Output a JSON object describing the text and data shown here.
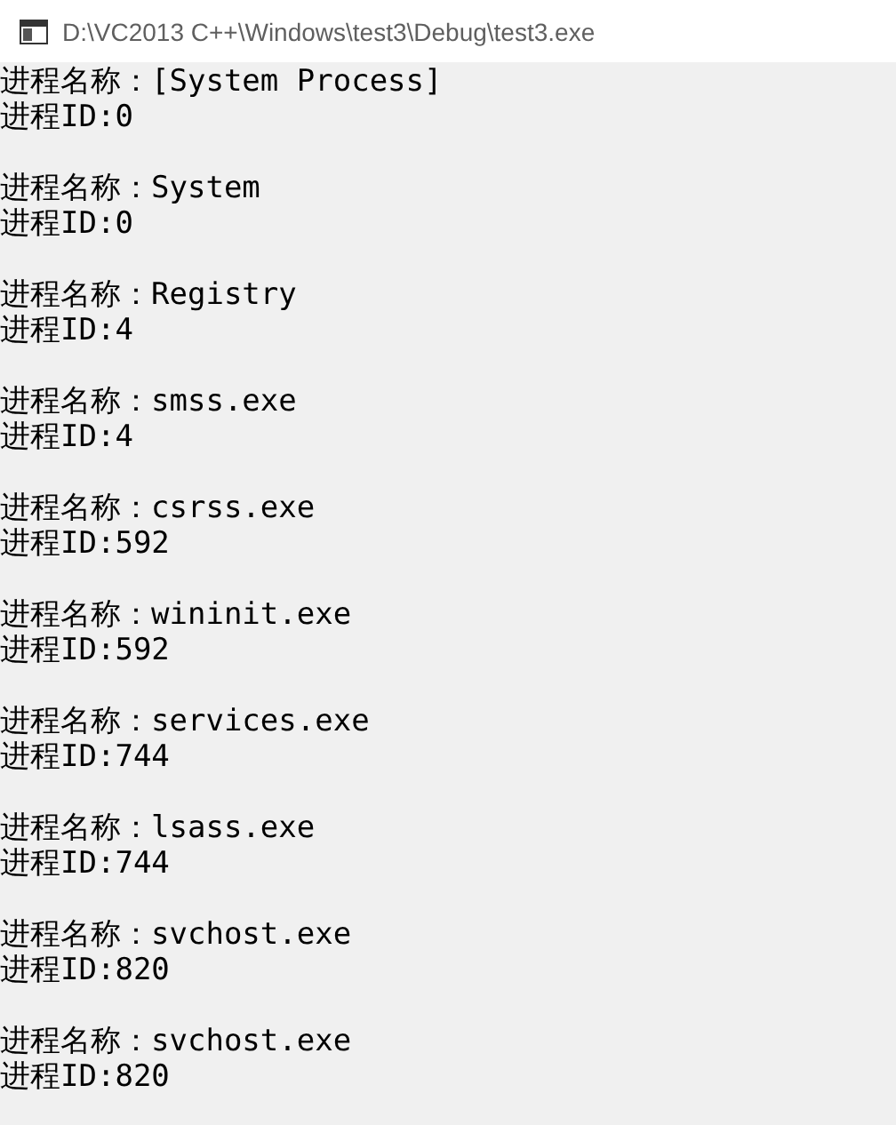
{
  "window": {
    "title": "D:\\VC2013 C++\\Windows\\test3\\Debug\\test3.exe"
  },
  "console": {
    "entries": [
      {
        "name_line": "进程名称：[System Process]",
        "id_line": "进程ID:0"
      },
      {
        "name_line": "进程名称：System",
        "id_line": "进程ID:0"
      },
      {
        "name_line": "进程名称：Registry",
        "id_line": "进程ID:4"
      },
      {
        "name_line": "进程名称：smss.exe",
        "id_line": "进程ID:4"
      },
      {
        "name_line": "进程名称：csrss.exe",
        "id_line": "进程ID:592"
      },
      {
        "name_line": "进程名称：wininit.exe",
        "id_line": "进程ID:592"
      },
      {
        "name_line": "进程名称：services.exe",
        "id_line": "进程ID:744"
      },
      {
        "name_line": "进程名称：lsass.exe",
        "id_line": "进程ID:744"
      },
      {
        "name_line": "进程名称：svchost.exe",
        "id_line": "进程ID:820"
      },
      {
        "name_line": "进程名称：svchost.exe",
        "id_line": "进程ID:820"
      }
    ]
  }
}
